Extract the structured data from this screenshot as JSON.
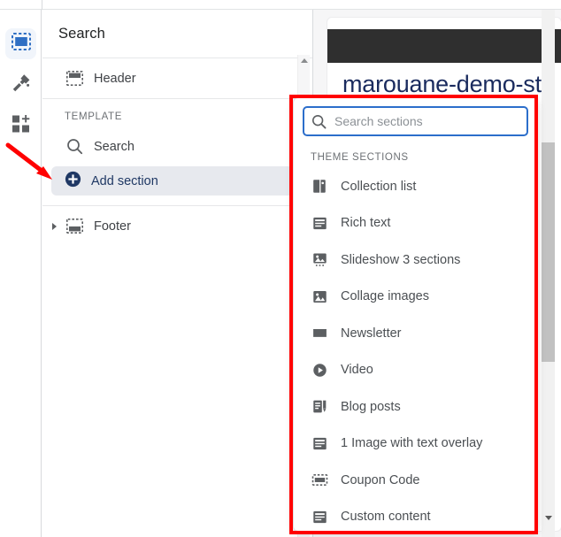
{
  "rail": {
    "items": [
      {
        "name": "sections-icon",
        "label": "Sections",
        "active": true
      },
      {
        "name": "theme-settings-icon",
        "label": "Theme settings",
        "active": false
      },
      {
        "name": "apps-icon",
        "label": "Apps",
        "active": false
      }
    ]
  },
  "panel": {
    "title": "Search",
    "header_row": {
      "label": "Header",
      "icon": "header-icon"
    },
    "group_label": "TEMPLATE",
    "template_rows": [
      {
        "label": "Search",
        "icon": "search-icon"
      }
    ],
    "add_section": {
      "label": "Add section",
      "icon": "plus-circle-icon"
    },
    "footer_row": {
      "label": "Footer",
      "icon": "footer-icon"
    }
  },
  "preview": {
    "store_title": "marouane-demo-sto",
    "fragment": "t"
  },
  "dropdown": {
    "search": {
      "value": "",
      "placeholder": "Search sections",
      "icon": "search-icon"
    },
    "group_label": "THEME SECTIONS",
    "sections": [
      {
        "label": "Collection list",
        "icon": "tag-icon"
      },
      {
        "label": "Rich text",
        "icon": "text-block-icon"
      },
      {
        "label": "Slideshow 3 sections",
        "icon": "slideshow-icon"
      },
      {
        "label": "Collage images",
        "icon": "image-icon"
      },
      {
        "label": "Newsletter",
        "icon": "envelope-icon"
      },
      {
        "label": "Video",
        "icon": "play-circle-icon"
      },
      {
        "label": "Blog posts",
        "icon": "blog-icon"
      },
      {
        "label": "1 Image with text overlay",
        "icon": "image-text-icon"
      },
      {
        "label": "Coupon Code",
        "icon": "coupon-icon"
      },
      {
        "label": "Custom content",
        "icon": "custom-content-icon"
      }
    ]
  },
  "annotations": {
    "highlight_color": "#ff0000",
    "arrow_color": "#ff0000"
  },
  "colors": {
    "accent_blue": "#2c6ecb",
    "rail_active_bg": "#f1f5fb",
    "selected_row_bg": "#e7e9ee",
    "icon_gray": "#5c5f62"
  }
}
